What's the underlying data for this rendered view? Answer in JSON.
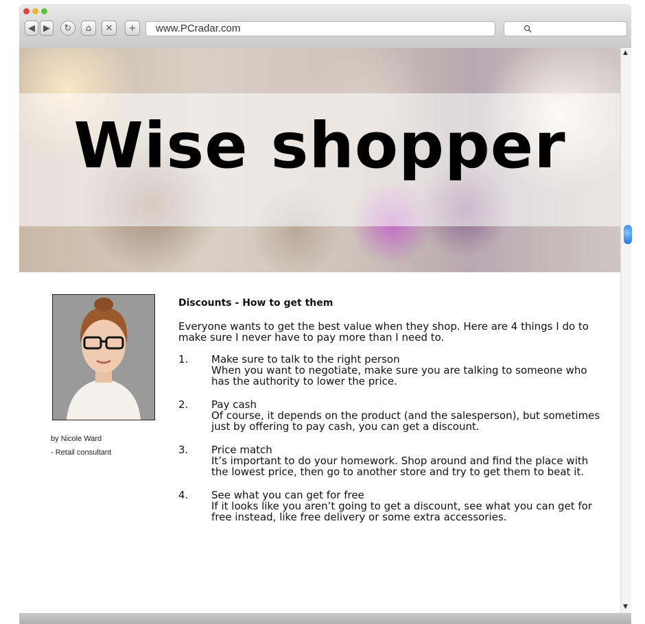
{
  "browser": {
    "url": "www.PCradar.com",
    "nav": {
      "back": "◀",
      "forward": "▶",
      "reload": "↻",
      "home": "⌂",
      "close": "✕",
      "new_tab": "+"
    },
    "search_icon": "🔍"
  },
  "hero": {
    "title": "Wise shopper"
  },
  "author": {
    "name": "by Nicole Ward",
    "role": "- Retail consultant"
  },
  "article": {
    "heading": "Discounts - How to get them",
    "intro": "Everyone wants to get the best value when they shop. Here are 4 things I do to make sure I never have to pay more than I need to.",
    "items": [
      {
        "number": "1.",
        "title": "Make sure to talk to the right person",
        "body": "When you want to negotiate, make sure you are talking to someone who has the authority to lower the price."
      },
      {
        "number": "2.",
        "title": "Pay cash",
        "body": "Of course, it depends on the product (and the salesperson), but sometimes just by offering to pay cash, you can get a discount."
      },
      {
        "number": "3.",
        "title": "Price match",
        "body": "It’s important to do your homework. Shop around and find the place with the lowest price, then go to another store and try to get them to beat it."
      },
      {
        "number": "4.",
        "title": "See what you can get for free",
        "body": "If it looks like you aren’t going to get a discount, see what you can get for free instead, like free delivery or some extra accessories."
      }
    ]
  },
  "colors": {
    "accent": "#1a6fd0",
    "title": "#000000"
  }
}
